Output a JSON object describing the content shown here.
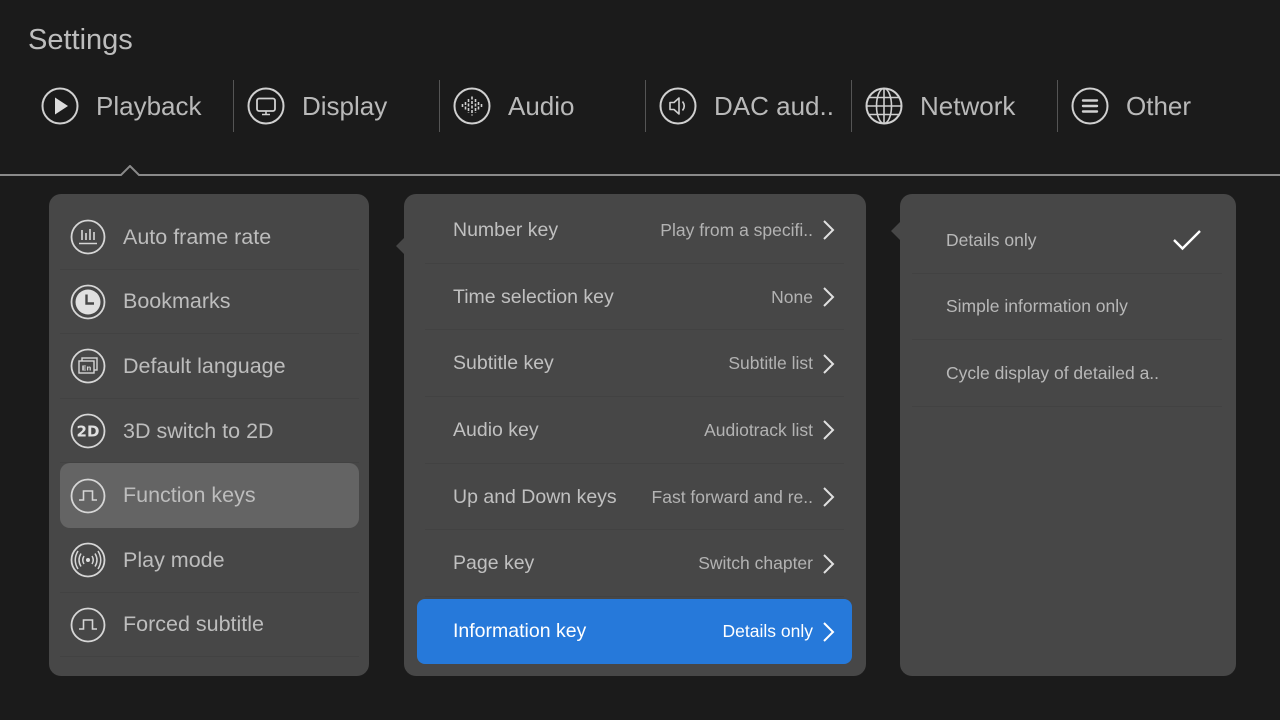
{
  "header": {
    "title": "Settings"
  },
  "tabs": [
    {
      "label": "Playback",
      "icon": "play-circle-icon",
      "active": true
    },
    {
      "label": "Display",
      "icon": "monitor-icon"
    },
    {
      "label": "Audio",
      "icon": "audio-waveform-icon"
    },
    {
      "label": "DAC aud..",
      "icon": "speaker-icon"
    },
    {
      "label": "Network",
      "icon": "globe-icon"
    },
    {
      "label": "Other",
      "icon": "menu-lines-icon"
    }
  ],
  "left_menu": {
    "items": [
      {
        "label": "Auto frame rate",
        "icon": "bar-chart-icon"
      },
      {
        "label": "Bookmarks",
        "icon": "clock-icon"
      },
      {
        "label": "Default language",
        "icon": "language-en-icon"
      },
      {
        "label": "3D switch to 2D",
        "icon": "2d-icon"
      },
      {
        "label": "Function keys",
        "icon": "pulse-wave-icon",
        "selected": true
      },
      {
        "label": "Play mode",
        "icon": "broadcast-icon"
      },
      {
        "label": "Forced subtitle",
        "icon": "pulse-wave-icon"
      }
    ]
  },
  "function_keys": {
    "items": [
      {
        "label": "Number key",
        "value": "Play from a specifi.."
      },
      {
        "label": "Time selection key",
        "value": "None"
      },
      {
        "label": "Subtitle key",
        "value": "Subtitle list"
      },
      {
        "label": "Audio key",
        "value": "Audiotrack list"
      },
      {
        "label": "Up and Down keys",
        "value": "Fast forward and re.."
      },
      {
        "label": "Page key",
        "value": "Switch chapter"
      },
      {
        "label": "Information key",
        "value": "Details only",
        "selected": true
      }
    ]
  },
  "information_key_options": {
    "items": [
      {
        "label": "Details only",
        "checked": true
      },
      {
        "label": "Simple information only",
        "checked": false
      },
      {
        "label": "Cycle display of detailed a..",
        "checked": false
      }
    ]
  },
  "colors": {
    "background": "#1b1b1b",
    "panel": "#474747",
    "selected_item": "#646464",
    "accent": "#2679da"
  }
}
